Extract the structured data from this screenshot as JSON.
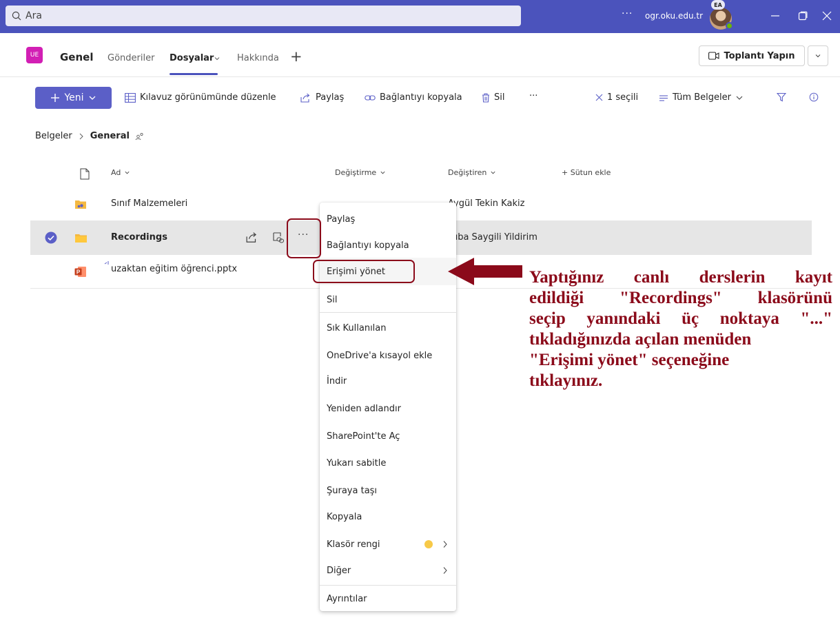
{
  "titlebar": {
    "search_placeholder": "Ara",
    "more_label": "···",
    "org_label": "ogr.oku.edu.tr",
    "avatar_initials": "EA"
  },
  "channel": {
    "team_initials": "UE",
    "name": "Genel",
    "tabs": [
      {
        "label": "Gönderiler",
        "active": false
      },
      {
        "label": "Dosyalar",
        "active": true
      },
      {
        "label": "Hakkında",
        "active": false
      }
    ],
    "add_tab_label": "+",
    "meet_label": "Toplantı Yapın"
  },
  "toolbar": {
    "new_label": "Yeni",
    "grid_edit_label": "Kılavuz görünümünde düzenle",
    "share_label": "Paylaş",
    "copy_link_label": "Bağlantıyı kopyala",
    "delete_label": "Sil",
    "more_label": "···",
    "selected_label": "1 seçili",
    "view_label": "Tüm Belgeler"
  },
  "breadcrumb": {
    "root": "Belgeler",
    "separator": ">",
    "current": "General"
  },
  "columns": {
    "name": "Ad",
    "modified": "Değiştirme",
    "modified_by": "Değiştiren",
    "add_column": "+ Sütun ekle"
  },
  "files": [
    {
      "name": "Sınıf Malzemeleri",
      "type": "shared-folder",
      "modified_by": "Aygül Tekin Kakiz",
      "selected": false
    },
    {
      "name": "Recordings",
      "type": "folder",
      "modified_by": "Tuba Saygili Yildirim",
      "selected": true
    },
    {
      "name": "uzaktan eğitim öğrenci.pptx",
      "type": "pptx",
      "modified_by": "...",
      "selected": false
    }
  ],
  "context_menu": {
    "items": [
      "Paylaş",
      "Bağlantıyı kopyala",
      "Erişimi yönet",
      "Sil",
      "Sık Kullanılan",
      "OneDrive'a kısayol ekle",
      "İndir",
      "Yeniden adlandır",
      "SharePoint'te Aç",
      "Yukarı sabitle",
      "Şuraya taşı",
      "Kopyala",
      "Klasör rengi",
      "Diğer",
      "Ayrıntılar"
    ],
    "folder_color_swatch": "#f7c948"
  },
  "annotation": {
    "lines": [
      "Yaptığınız canlı derslerin kayıt",
      "edildiği \"Recordings\" klasörünü",
      "seçip yanındaki üç noktaya \"...\"",
      "tıkladığınızda açılan menüden",
      "\"Erişimi yönet\" seçeneğine",
      "tıklayınız."
    ],
    "color": "#8b0a1a"
  },
  "colors": {
    "brand": "#4b53bc",
    "primary_button": "#5b5fc7",
    "team_tile": "#d21fb4"
  }
}
